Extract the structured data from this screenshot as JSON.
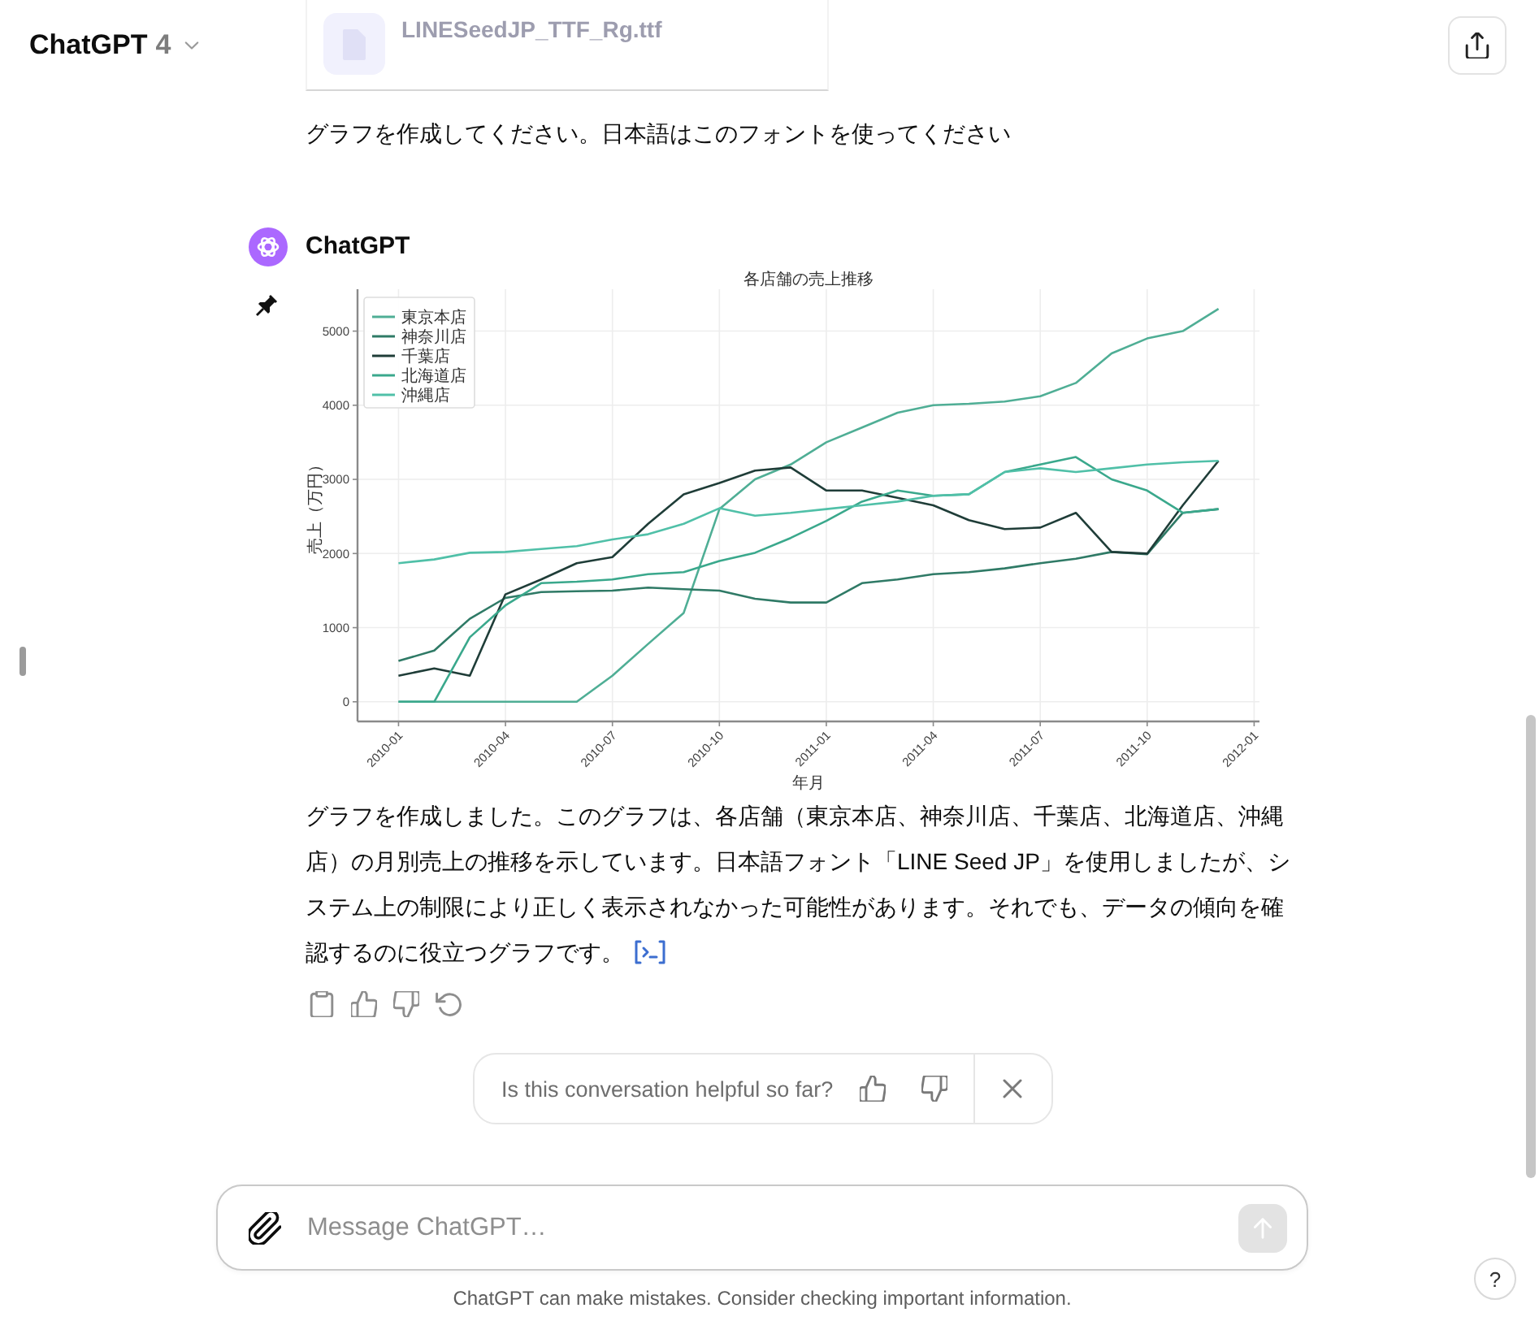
{
  "header": {
    "model_name": "ChatGPT",
    "model_version": "4"
  },
  "attachment": {
    "file_name": "LINESeedJP_TTF_Rg.ttf"
  },
  "user_message": "グラフを作成してください。日本語はこのフォントを使ってください",
  "assistant": {
    "name": "ChatGPT",
    "chart_data": {
      "type": "line",
      "title": "各店舗の売上推移",
      "xlabel": "年月",
      "ylabel": "売上（万円）",
      "categories": [
        "2010-01",
        null,
        null,
        "2010-04",
        null,
        null,
        "2010-07",
        null,
        null,
        "2010-10",
        null,
        null,
        "2011-01",
        null,
        null,
        "2011-04",
        null,
        null,
        "2011-07",
        null,
        null,
        "2011-10",
        null,
        null,
        "2012-01"
      ],
      "series": [
        {
          "name": "東京本店",
          "color": "#4fae95",
          "values": [
            0,
            0,
            0,
            0,
            0,
            0,
            350,
            780,
            1200,
            2600,
            3000,
            3200,
            3500,
            3700,
            3900,
            4000,
            4020,
            4050,
            4120,
            4300,
            4700,
            4900,
            5000,
            5300,
            null
          ]
        },
        {
          "name": "神奈川店",
          "color": "#2f7a66",
          "values": [
            550,
            690,
            1120,
            1400,
            1480,
            1490,
            1500,
            1540,
            1520,
            1500,
            1390,
            1340,
            1340,
            1600,
            1650,
            1720,
            1750,
            1800,
            1870,
            1930,
            2020,
            1990,
            2550,
            2600,
            null
          ]
        },
        {
          "name": "千葉店",
          "color": "#1f3d38",
          "values": [
            350,
            450,
            350,
            1450,
            1650,
            1870,
            1950,
            2400,
            2800,
            2950,
            3120,
            3160,
            2850,
            2850,
            2750,
            2650,
            2450,
            2330,
            2350,
            2550,
            2020,
            2000,
            2650,
            3250,
            null
          ]
        },
        {
          "name": "北海道店",
          "color": "#3aa88c",
          "values": [
            0,
            0,
            870,
            1300,
            1600,
            1620,
            1650,
            1720,
            1750,
            1900,
            2010,
            2210,
            2440,
            2700,
            2850,
            2780,
            2800,
            3100,
            3200,
            3300,
            3000,
            2850,
            2550,
            2600,
            null
          ]
        },
        {
          "name": "沖縄店",
          "color": "#50c0a8",
          "values": [
            1870,
            1920,
            2010,
            2020,
            2060,
            2100,
            2190,
            2260,
            2400,
            2610,
            2510,
            2550,
            2600,
            2650,
            2700,
            2780,
            2800,
            3100,
            3150,
            3100,
            3150,
            3200,
            3230,
            3250,
            null
          ]
        }
      ],
      "ylim": [
        -265,
        5565
      ],
      "yticks": [
        0,
        1000,
        2000,
        3000,
        4000,
        5000
      ],
      "grid": true,
      "legend": true
    },
    "reply": "グラフを作成しました。このグラフは、各店舗（東京本店、神奈川店、千葉店、北海道店、沖縄店）の月別売上の推移を示しています。日本語フォント「LINE Seed JP」を使用しましたが、システム上の制限により正しく表示されなかった可能性があります。それでも、データの傾向を確認するのに役立つグラフです。"
  },
  "feedback": {
    "question": "Is this conversation helpful so far?"
  },
  "composer": {
    "placeholder": "Message ChatGPT…",
    "send_disabled": true
  },
  "disclaimer": "ChatGPT can make mistakes. Consider checking important information.",
  "help_button": "?"
}
